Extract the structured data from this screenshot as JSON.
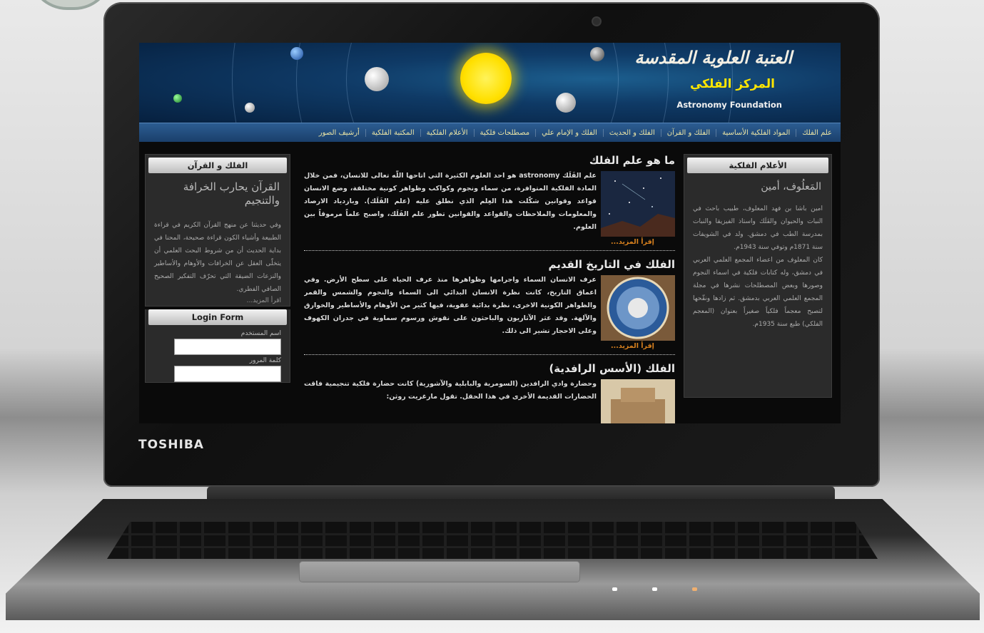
{
  "site": {
    "logo_text": "العتبة العلوية المقدسة",
    "center_name": "المركز الفلكي",
    "center_name_en": "Astronomy Foundation"
  },
  "nav": {
    "items": [
      "علم الفلك",
      "المواد الفلكية الأساسية",
      "الفلك و القرآن",
      "الفلك و الحديث",
      "الفلك و الإمام علي",
      "مصطلحات فلكية",
      "الأعلام الفلكية",
      "المكتبة الفلكية",
      "أرشيف الصور"
    ]
  },
  "right_box": {
    "title": "الأعلام الفلكية",
    "name": "المَعلُوف، أمين",
    "paragraphs": [
      "امين باشا بن فهد المعلوف، طبيب باحث في النبات والحيوان والفَلَك واستاذ الفيزيقا والنبات بمدرسة الطب في دمشق. ولد في الشويفات سنة 1871م وتوفي سنة 1943م.",
      "كان المعلوف من اعضاء المجمع العلمي العربي في دمشق، وله كتابات فلكية في اسماء النجوم وصورها وبعض المصطلحات نشرها في مجلة المجمع العلمي العربي بدمشق. ثم زادها ونقّحها لتصبح معجماً فلكياً صغيراً بعنوان (المعجم الفلكي) طبع سنة 1935م."
    ]
  },
  "left_box": {
    "title": "الفلك و القرآن",
    "headline": "القرآن يحارب الخرافة والتنجيم",
    "body": "وفي حديثنا عن منهج القرآن الكريم في قراءة الطبيعة وأشياء الكون قراءة صحيحة، المحنا في بداية الحديث أن من شروط البحث العلمي أن يتخلّى العقل عن الخرافات والأوهام والأساطير والنزعات الضيقة التي تحرّف التفكير الصحيح الصافي الفطري.",
    "read_more": "اقرأ المزيد..."
  },
  "login": {
    "title": "Login Form",
    "username_label": "اسم المستخدم",
    "password_label": "كلمة المرور",
    "username_value": "",
    "password_value": ""
  },
  "articles": [
    {
      "title": "ما هو علم الفلك",
      "text": "علم الفَلَك astronomy هو احد العلوم الكثيرة التي اتاحها اللّه تعالى للانسان، فمن خلال المادة الفلكية المتوافرة، من سماء ونجوم وكواكب وظواهر كونية مختلفة، وضع الانسان قواعد وقوانين شكّلت هذا العِلم الذي نطلق عليه (علم الفَلَك). وبازدياد الارصاد والمعلومات والملاحظات والقواعد والقوانين تطور علم الفَلَك، واصبح علماً مرموقاً بين العلوم.",
      "read_more": "إقرأ المزيد..."
    },
    {
      "title": "الفلك في التاريخ القديم",
      "text": "عرف الانسان السماء واجرامها وظواهرها منذ عرف الحياة على سطح الأرض. وفي اعماق التاريخ، كانت نظرة الانسان البدائي الى السماء والنجوم والشمس والقمر والظواهر الكونية الاخرى، نظرة بدائية عفوية، فيها كثير من الأوهام والأساطير والخوارق والآلهة. وقد عثر الآثاريون والباحثون على نقوش ورسوم سماوية في جدران الكهوف وعلى الاحجار تشير الى ذلك.",
      "read_more": "إقرأ المزيد..."
    },
    {
      "title": "الفلك (الأسس الرافدية)",
      "text": "وحضارة وادي الرافدين (السومرية والبابلية والآشورية) كانت حضارة فلكية تنجيمية فاقت الحضارات القديمة الأخرى في هذا الحقل. تقول مارغريت روثن:",
      "read_more": ""
    }
  ],
  "device": {
    "brand": "TOSHIBA"
  }
}
